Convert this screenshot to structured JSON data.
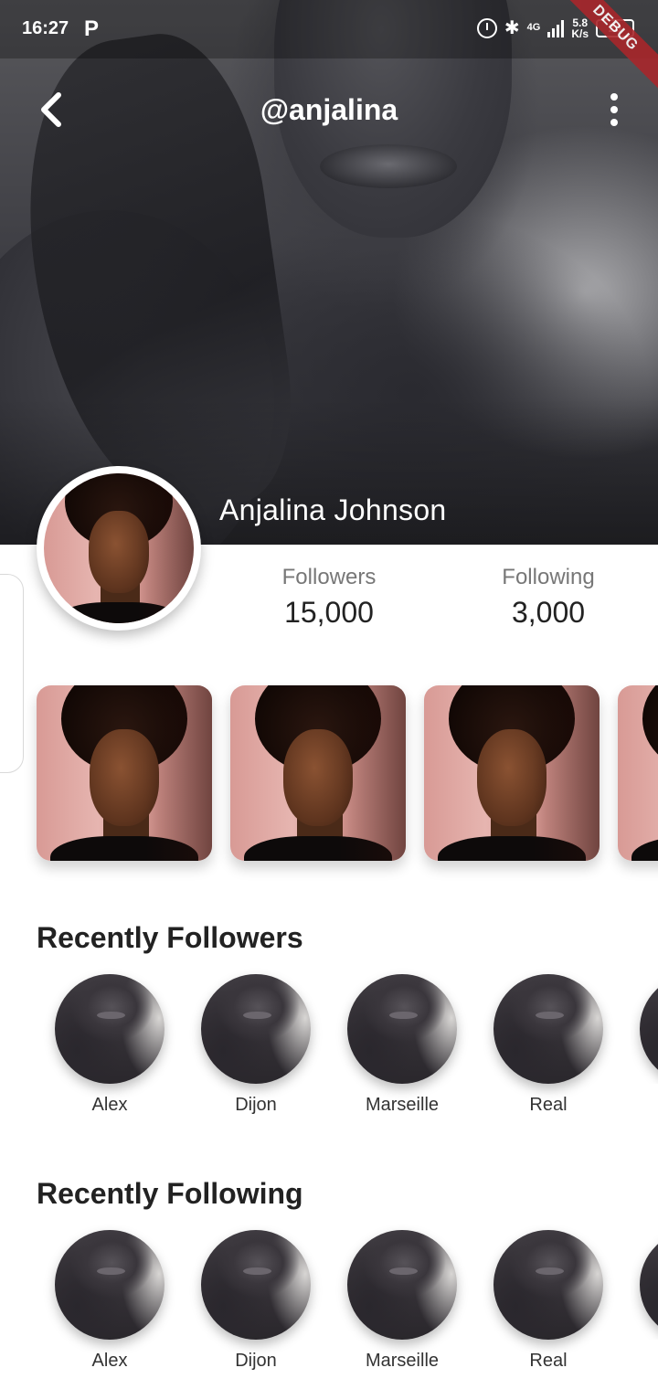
{
  "status_bar": {
    "time": "16:27",
    "app_icon": "P",
    "network": "4G",
    "speed_value": "5.8",
    "speed_unit": "K/s",
    "battery": "20"
  },
  "debug_banner": "DEBUG",
  "header": {
    "handle": "@anjalina",
    "back_icon": "chevron-left-icon",
    "menu_icon": "more-vertical-icon"
  },
  "profile": {
    "name": "Anjalina Johnson",
    "followers_label": "Followers",
    "followers_value": "15,000",
    "following_label": "Following",
    "following_value": "3,000"
  },
  "sections": {
    "followers_title": "Recently Followers",
    "following_title": "Recently Following"
  },
  "recent_followers": [
    "Alex",
    "Dijon",
    "Marseille",
    "Real"
  ],
  "recent_following": [
    "Alex",
    "Dijon",
    "Marseille",
    "Real"
  ],
  "colors": {
    "debug_banner": "#a8262b",
    "text_primary": "#222222",
    "text_secondary": "#777777"
  }
}
